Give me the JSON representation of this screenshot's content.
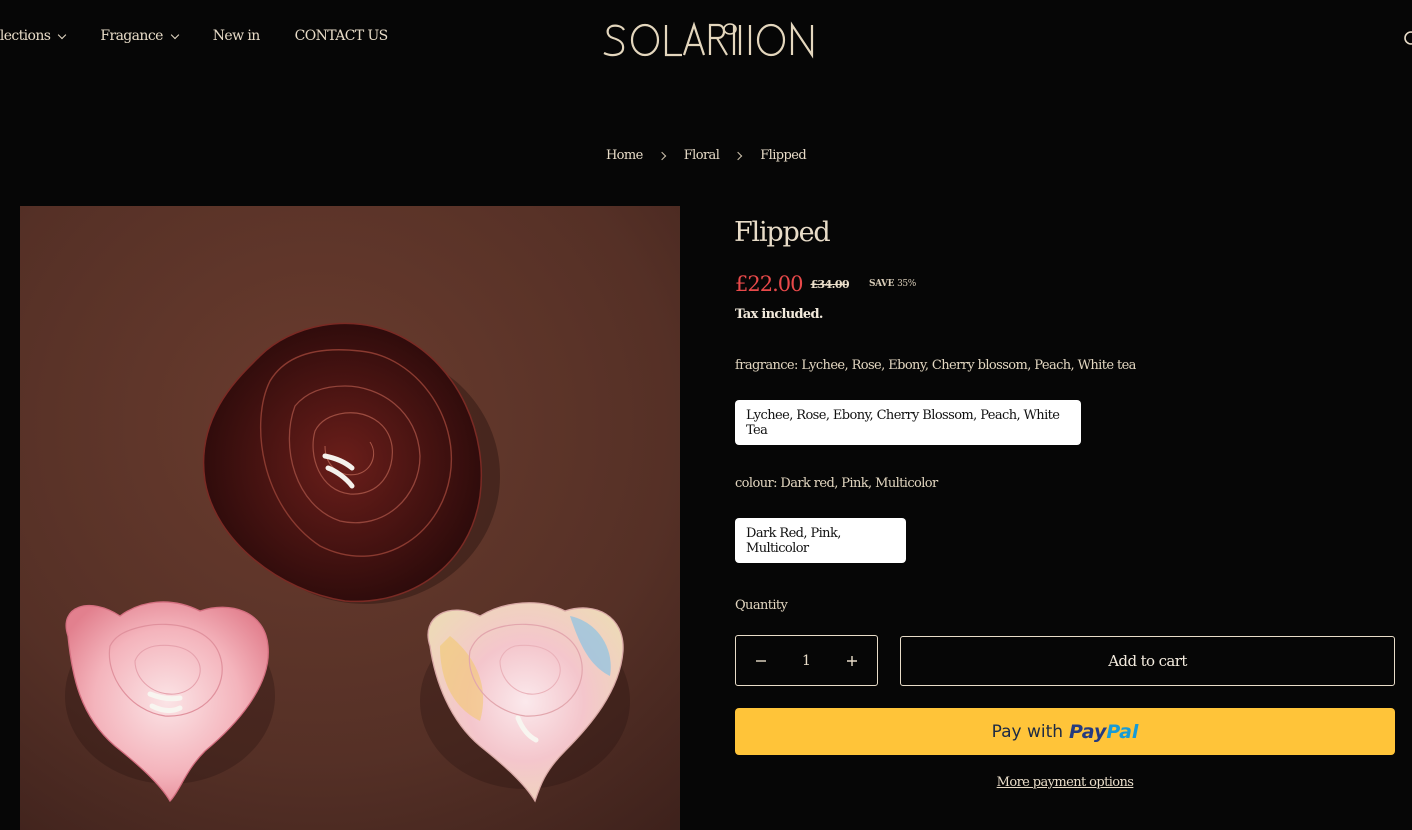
{
  "header": {
    "nav": [
      {
        "label": "Collections",
        "has_dropdown": true
      },
      {
        "label": "Fragance",
        "has_dropdown": true
      },
      {
        "label": "New in",
        "has_dropdown": false
      },
      {
        "label": "CONTACT US",
        "has_dropdown": false
      }
    ],
    "logo_text": "SOLARION",
    "search_icon": "search-icon"
  },
  "breadcrumb": [
    "Home",
    "Floral",
    "Flipped"
  ],
  "product": {
    "title": "Flipped",
    "price": "£22.00",
    "compare_price": "£34.00",
    "save_label": "SAVE",
    "save_value": "35%",
    "tax_note": "Tax included.",
    "fragrance_label": "fragrance: Lychee, Rose, Ebony, Cherry blossom, Peach, White tea",
    "fragrance_option": "Lychee, Rose, Ebony, Cherry Blossom, Peach, White Tea",
    "colour_label": "colour: Dark red, Pink, Multicolor",
    "colour_option": "Dark Red, Pink, Multicolor",
    "quantity_label": "Quantity",
    "quantity_value": "1",
    "add_to_cart": "Add to cart",
    "paypal_prefix": "Pay with",
    "paypal_brand_pay": "Pay",
    "paypal_brand_pal": "Pal",
    "more_payment": "More payment options"
  },
  "colors": {
    "background": "#060606",
    "text": "#e8dcc8",
    "sale_price": "#e8494a",
    "paypal_button": "#ffc439"
  }
}
